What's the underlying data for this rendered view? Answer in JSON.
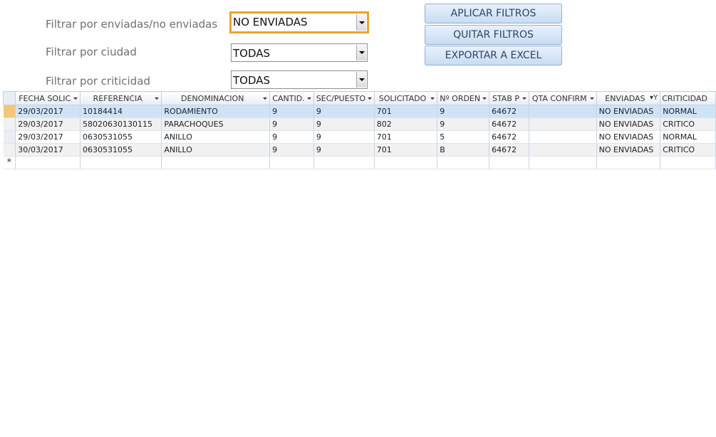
{
  "filters": {
    "enviadas_label": "Filtrar por enviadas/no enviadas",
    "enviadas_value": "NO ENVIADAS",
    "ciudad_label": "Filtrar por ciudad",
    "ciudad_value": "TODAS",
    "criticidad_label": "Filtrar por criticidad",
    "criticidad_value": "TODAS"
  },
  "buttons": {
    "apply": "APLICAR FILTROS",
    "clear": "QUITAR FILTROS",
    "export": "EXPORTAR A EXCEL"
  },
  "table": {
    "columns": [
      "FECHA SOLIC",
      "REFERENCIA",
      "DENOMINACION",
      "CANTID.",
      "SEC/PUESTO",
      "SOLICITADO",
      "Nº ORDEN",
      "STAB P",
      "QTA CONFIRM",
      "ENVIADAS",
      "CRITICIDAD"
    ],
    "rows": [
      [
        "29/03/2017",
        "10184414",
        "RODAMIENTO",
        "9",
        "9",
        "701",
        "9",
        "64672",
        "",
        "NO ENVIADAS",
        "NORMAL"
      ],
      [
        "29/03/2017",
        "58020630130115",
        "PARACHOQUES",
        "9",
        "9",
        "802",
        "9",
        "64672",
        "",
        "NO ENVIADAS",
        "CRITICO"
      ],
      [
        "29/03/2017",
        "0630531055",
        "ANILLO",
        "9",
        "9",
        "701",
        "5",
        "64672",
        "",
        "NO ENVIADAS",
        "NORMAL"
      ],
      [
        "30/03/2017",
        "0630531055",
        "ANILLO",
        "9",
        "9",
        "701",
        "B",
        "64672",
        "",
        "NO ENVIADAS",
        "CRITICO"
      ]
    ],
    "new_record_marker": "*"
  }
}
